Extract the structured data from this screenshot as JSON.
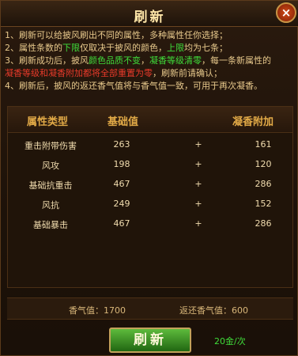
{
  "window": {
    "title": "刷新",
    "close_glyph": "×"
  },
  "notes": [
    [
      "1、刷新可以给披风刷出不同的属性，多种属性任你选择；"
    ],
    [
      "2、属性条数的",
      "下限",
      "仅取决于披风的颜色，",
      "上限",
      "均为七条；"
    ],
    [
      "3、刷新成功后，披风",
      "颜色品质不变",
      "，",
      "凝香等级清零",
      "，每一条新属性的"
    ],
    [
      "凝香等级和凝香附加都将全部重置为零",
      "，刷新前请确认；"
    ],
    [
      "4、刷新后，披风的返还香气值将与香气值一致，可用于再次凝香。"
    ]
  ],
  "table": {
    "headers": {
      "type": "属性类型",
      "base": "基础值",
      "bonus": "凝香附加"
    },
    "rows": [
      {
        "name": "重击附带伤害",
        "base": "263",
        "plus": "+",
        "bonus": "161"
      },
      {
        "name": "风攻",
        "base": "198",
        "plus": "+",
        "bonus": "120"
      },
      {
        "name": "基础抗重击",
        "base": "467",
        "plus": "+",
        "bonus": "286"
      },
      {
        "name": "风抗",
        "base": "249",
        "plus": "+",
        "bonus": "152"
      },
      {
        "name": "基础暴击",
        "base": "467",
        "plus": "+",
        "bonus": "286"
      }
    ]
  },
  "stats": {
    "fragrance": "香气值：1700",
    "returned": "返还香气值：600"
  },
  "refresh_button": "刷新",
  "cost": "20金/次"
}
